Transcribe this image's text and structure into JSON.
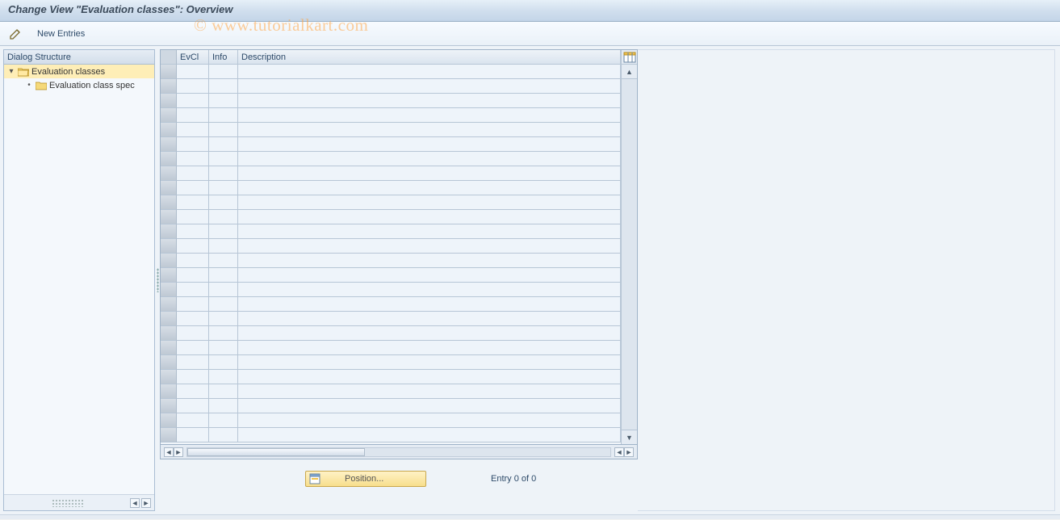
{
  "title": "Change View \"Evaluation classes\": Overview",
  "toolbar": {
    "new_entries_label": "New Entries"
  },
  "watermark": "© www.tutorialkart.com",
  "dialog_structure": {
    "header": "Dialog Structure",
    "items": [
      {
        "label": "Evaluation classes",
        "selected": true,
        "open": true
      },
      {
        "label": "Evaluation class spec",
        "selected": false,
        "open": false
      }
    ]
  },
  "table": {
    "columns": {
      "evcl": "EvCl",
      "info": "Info",
      "description": "Description"
    },
    "rows_visible": 26
  },
  "footer": {
    "position_label": "Position...",
    "entry_status": "Entry 0 of 0"
  },
  "icons": {
    "toggle": "toggle-display-change-icon"
  }
}
